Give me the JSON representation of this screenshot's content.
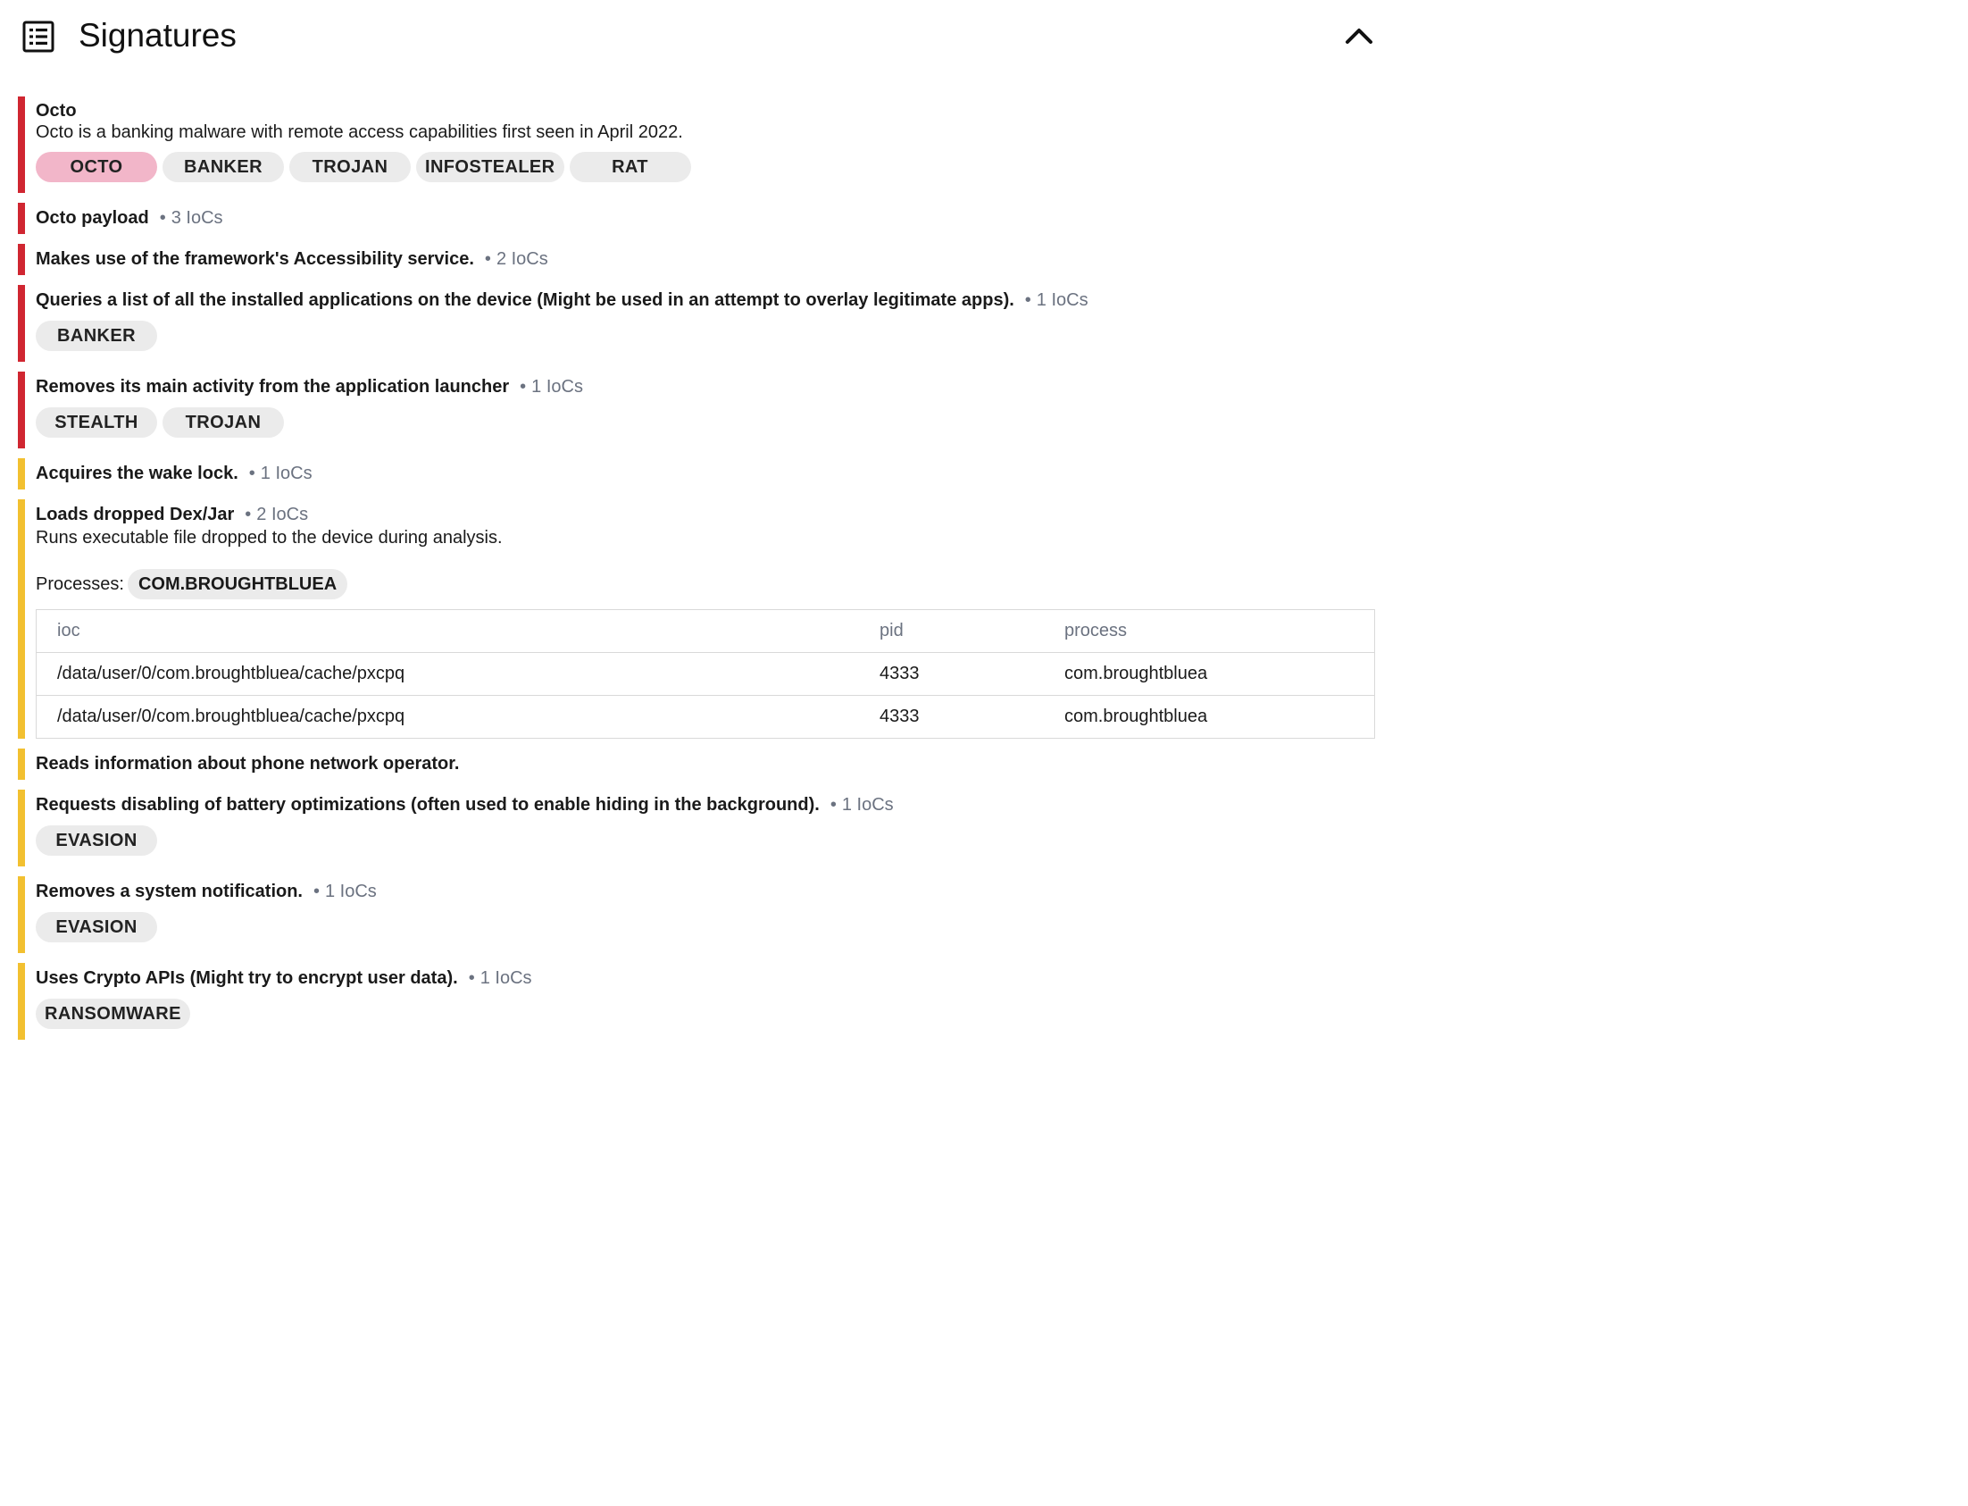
{
  "header": {
    "title": "Signatures",
    "icon": "list-icon",
    "collapse_icon": "chevron-up-icon"
  },
  "colors": {
    "high": "#d02631",
    "medium": "#f2c030",
    "tag_default": "#ebebeb",
    "tag_highlight": "#f2b6c9"
  },
  "signatures": [
    {
      "severity": "high",
      "title": "Octo",
      "iocs": "",
      "description": "Octo is a banking malware with remote access capabilities first seen in April 2022.",
      "tags": [
        "OCTO",
        "BANKER",
        "TROJAN",
        "INFOSTEALER",
        "RAT"
      ]
    },
    {
      "severity": "high",
      "title": "Octo payload",
      "iocs": "3 IoCs"
    },
    {
      "severity": "high",
      "title": "Makes use of the framework's Accessibility service.",
      "iocs": "2 IoCs"
    },
    {
      "severity": "high",
      "title": "Queries a list of all the installed applications on the device (Might be used in an attempt to overlay legitimate apps).",
      "iocs": "1 IoCs",
      "tags": [
        "BANKER"
      ]
    },
    {
      "severity": "high",
      "title": "Removes its main activity from the application launcher",
      "iocs": "1 IoCs",
      "tags": [
        "STEALTH",
        "TROJAN"
      ]
    },
    {
      "severity": "medium",
      "title": "Acquires the wake lock.",
      "iocs": "1 IoCs"
    },
    {
      "severity": "medium",
      "title": "Loads dropped Dex/Jar",
      "iocs": "2 IoCs",
      "description": "Runs executable file dropped to the device during analysis.",
      "processes_label": "Processes:",
      "process_chip": "COM.BROUGHTBLUEA",
      "table": {
        "headers": [
          "ioc",
          "pid",
          "process"
        ],
        "rows": [
          [
            "/data/user/0/com.broughtbluea/cache/pxcpq",
            "4333",
            "com.broughtbluea"
          ],
          [
            "/data/user/0/com.broughtbluea/cache/pxcpq",
            "4333",
            "com.broughtbluea"
          ]
        ]
      }
    },
    {
      "severity": "medium",
      "title": "Reads information about phone network operator.",
      "iocs": ""
    },
    {
      "severity": "medium",
      "title": "Requests disabling of battery optimizations (often used to enable hiding in the background).",
      "iocs": "1 IoCs",
      "tags": [
        "EVASION"
      ]
    },
    {
      "severity": "medium",
      "title": "Removes a system notification.",
      "iocs": "1 IoCs",
      "tags": [
        "EVASION"
      ]
    },
    {
      "severity": "medium",
      "title": "Uses Crypto APIs (Might try to encrypt user data).",
      "iocs": "1 IoCs",
      "tags": [
        "RANSOMWARE"
      ]
    }
  ]
}
